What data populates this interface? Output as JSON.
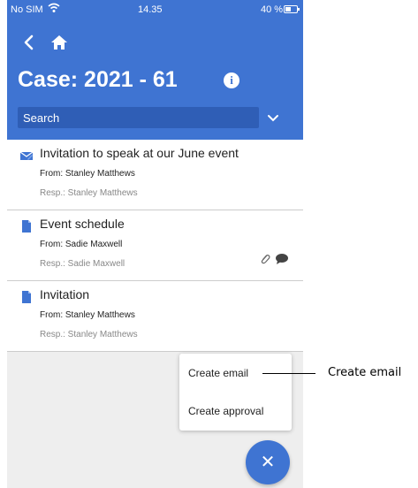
{
  "status_bar": {
    "carrier": "No SIM",
    "time": "14.35",
    "battery": "40 %"
  },
  "header": {
    "title": "Case: 2021 - 61"
  },
  "search": {
    "placeholder": "Search"
  },
  "items": [
    {
      "icon": "email-icon",
      "subject": "Invitation to speak at our June event",
      "from": "From: Stanley Matthews",
      "resp": "Resp.: Stanley Matthews"
    },
    {
      "icon": "document-icon",
      "subject": "Event schedule",
      "from": "From: Sadie Maxwell",
      "resp": "Resp.: Sadie Maxwell",
      "indicators": [
        "paperclip-icon",
        "comment-icon"
      ]
    },
    {
      "icon": "document-icon",
      "subject": "Invitation",
      "from": "From: Stanley Matthews",
      "resp": "Resp.: Stanley Matthews"
    }
  ],
  "menu": {
    "create_email": "Create email",
    "create_approval": "Create approval"
  },
  "fab": {
    "icon": "close-icon",
    "symbol": "✕"
  },
  "callout": {
    "label": "Create email"
  },
  "colors": {
    "accent": "#3f74d2",
    "search_bg": "#2f5eb6",
    "icon_blue": "#3f74d2"
  }
}
